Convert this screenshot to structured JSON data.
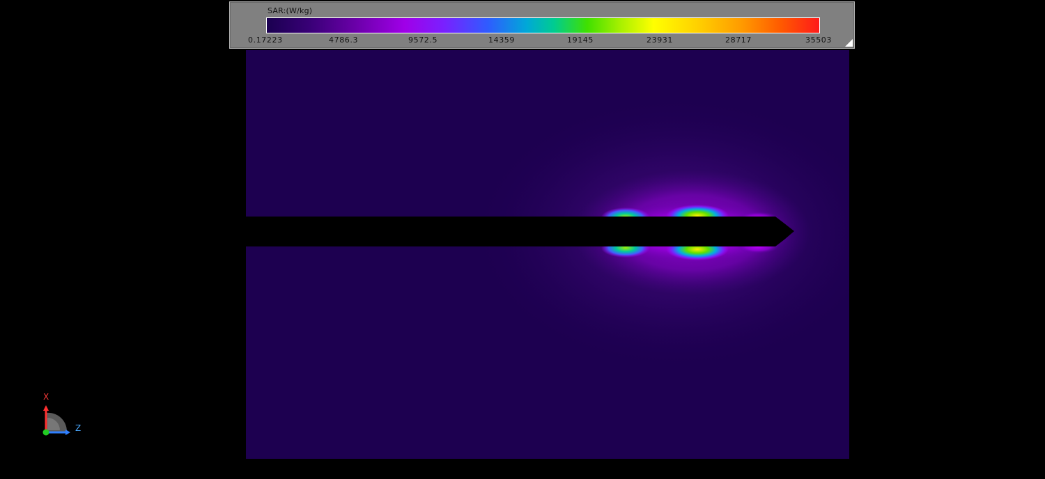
{
  "legend": {
    "title": "SAR:(W/kg)",
    "ticks": [
      "0.17223",
      "4786.3",
      "9572.5",
      "14359",
      "19145",
      "23931",
      "28717",
      "35503"
    ]
  },
  "triad": {
    "x_label": "X",
    "z_label": "Z"
  },
  "colors": {
    "background": "#000000",
    "field_base": "#1d0050",
    "probe": "#000000",
    "x_axis": "#ff3a3a",
    "z_axis": "#2f7fff",
    "y_axis": "#22cc22"
  }
}
